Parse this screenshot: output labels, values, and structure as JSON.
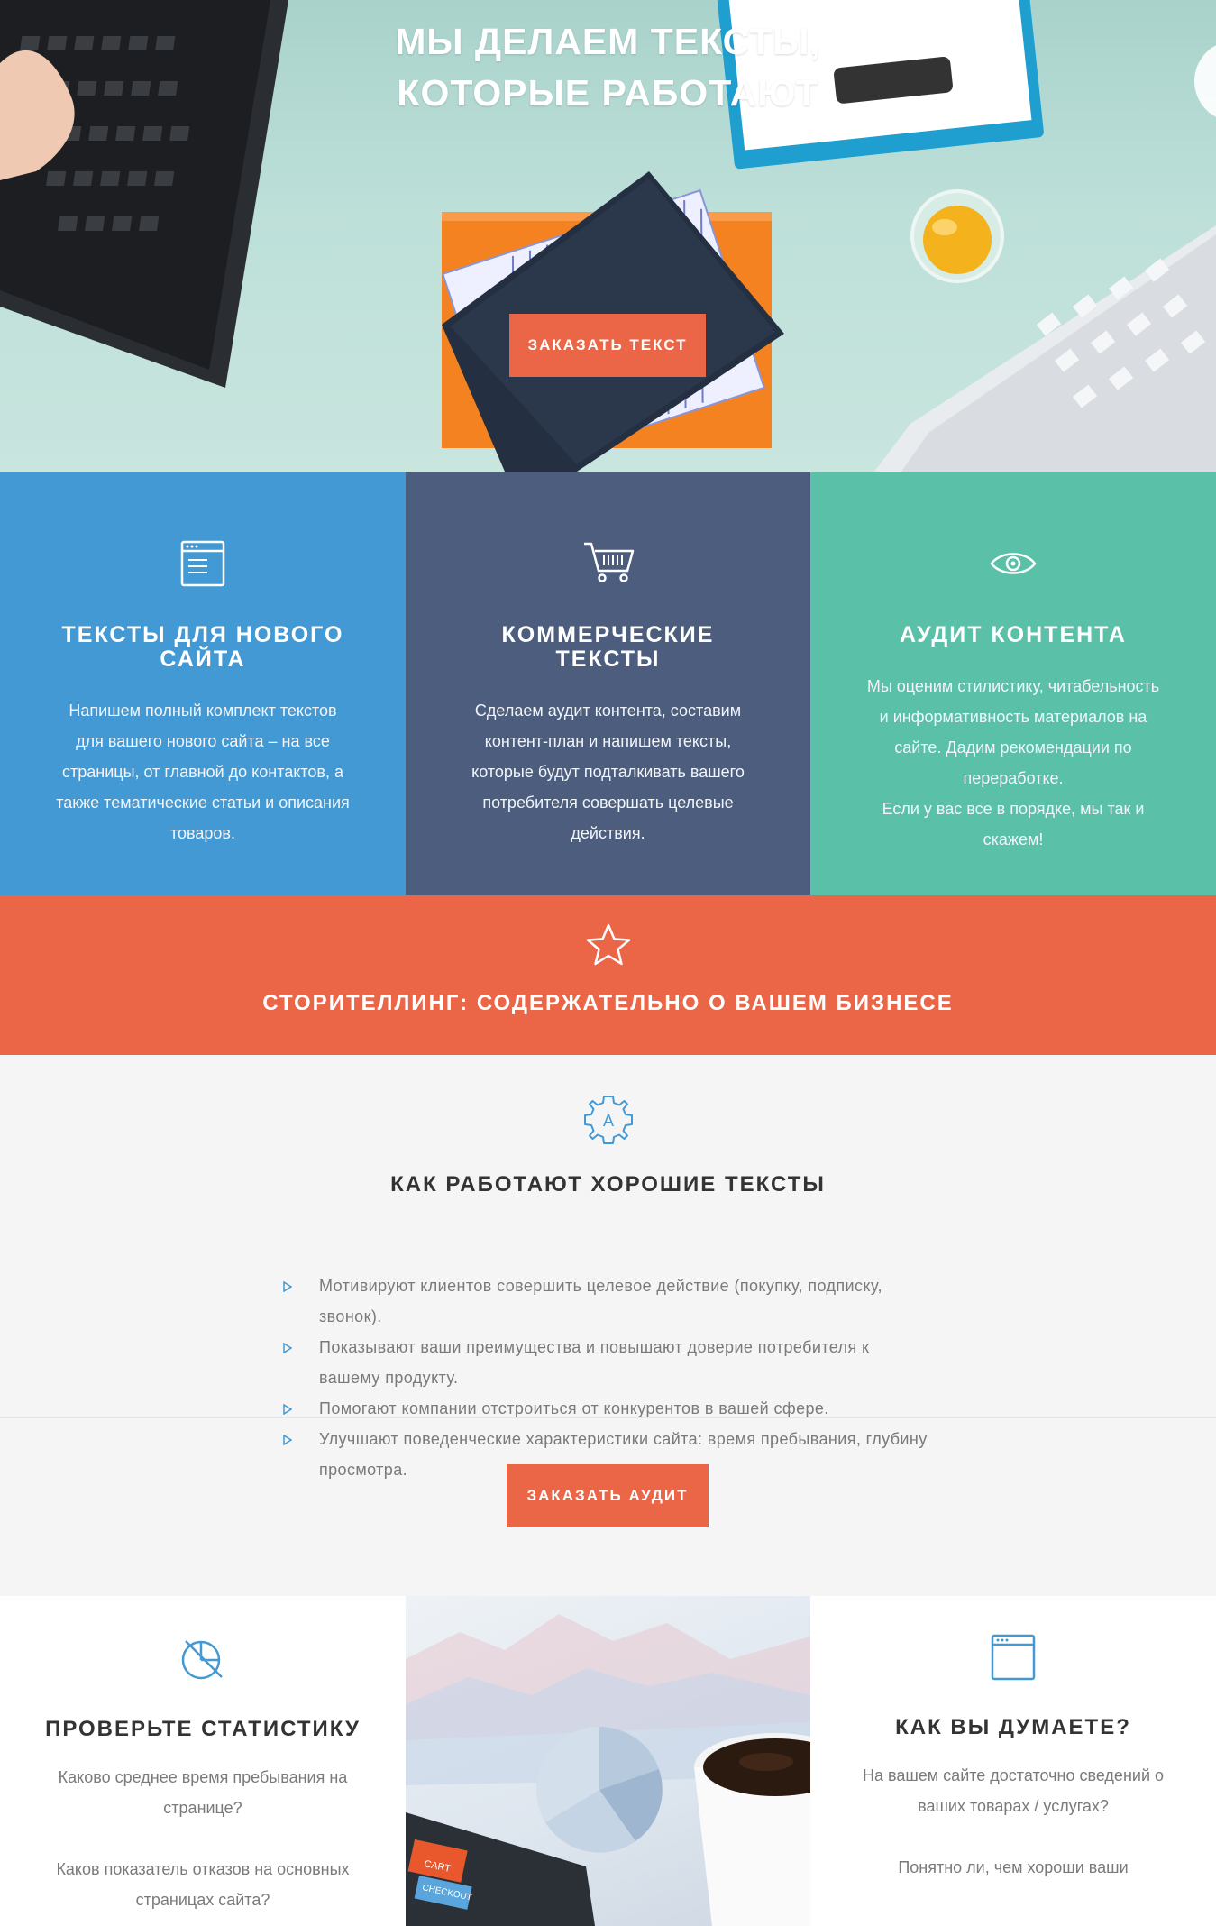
{
  "hero": {
    "title_line1": "МЫ ДЕЛАЕМ ТЕКСТЫ,",
    "title_line2": "КОТОРЫЕ РАБОТАЮТ",
    "cta_label": "ЗАКАЗАТЬ ТЕКСТ"
  },
  "features": [
    {
      "icon": "browser-window-icon",
      "title": "ТЕКСТЫ ДЛЯ НОВОГО САЙТА",
      "text": "Напишем полный комплект текстов для вашего нового сайта – на все страницы, от главной до контактов, а также тематические статьи и описания товаров."
    },
    {
      "icon": "shopping-cart-icon",
      "title": "КОММЕРЧЕСКИЕ ТЕКСТЫ",
      "text": "Сделаем аудит контента, составим контент-план и напишем тексты, которые будут подталкивать вашего потребителя совершать целевые действия."
    },
    {
      "icon": "eye-icon",
      "title": "АУДИТ КОНТЕНТА",
      "text": "Мы оценим стилистику, читабельность и информативность материалов на сайте. Дадим рекомендации по переработке.\nЕсли у вас все в порядке, мы так и скажем!"
    }
  ],
  "story": {
    "icon": "star-icon",
    "title": "СТОРИТЕЛЛИНГ: СОДЕРЖАТЕЛЬНО О ВАШЕМ БИЗНЕСЕ"
  },
  "how": {
    "icon": "gear-icon",
    "title": "КАК РАБОТАЮТ ХОРОШИЕ ТЕКСТЫ",
    "items": [
      "Мотивируют клиентов совершить целевое действие (покупку, подписку, звонок).",
      "Показывают ваши преимущества и повышают доверие потребителя к вашему продукту.",
      "Помогают компании отстроиться от конкурентов в вашей сфере.",
      "Улучшают поведенческие характеристики сайта: время пребывания, глубину просмотра."
    ],
    "cta_label": "ЗАКАЗАТЬ АУДИТ"
  },
  "bottom": {
    "left": {
      "icon": "chart-pie-icon",
      "title": "ПРОВЕРЬТЕ СТАТИСТИКУ",
      "q1": "Каково среднее время пребывания на странице?",
      "q2": "Каков показатель отказов на основных страницах сайта?"
    },
    "right": {
      "icon": "browser-window-icon",
      "title": "КАК ВЫ ДУМАЕТЕ?",
      "q1": "На вашем сайте достаточно сведений о ваших товарах / услугах?",
      "q2": "Понятно ли, чем хороши ваши"
    },
    "image_labels": {
      "cart": "CART",
      "checkout": "CHECKOUT"
    }
  },
  "colors": {
    "accent": "#eb6547",
    "blue": "#4399d4",
    "navy": "#4c5d7d",
    "teal": "#5bc0a8",
    "icon_blue": "#4399d4"
  }
}
